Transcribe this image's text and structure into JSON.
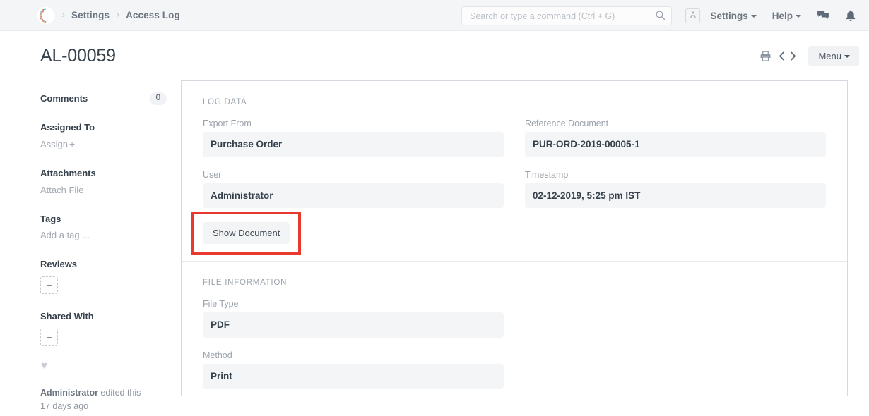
{
  "navbar": {
    "logo_name": "frappe-logo",
    "breadcrumbs": [
      {
        "label": "Settings"
      },
      {
        "label": "Access Log"
      }
    ],
    "separator": "›",
    "search": {
      "placeholder": "Search or type a command (Ctrl + G)",
      "value": "",
      "icon": "search-icon"
    },
    "avatar_initial": "A",
    "menus": [
      {
        "label": "Settings"
      },
      {
        "label": "Help"
      }
    ],
    "icons": [
      {
        "name": "chat-icon"
      },
      {
        "name": "bell-icon"
      }
    ]
  },
  "title_row": {
    "title": "AL-00059",
    "print_icon": "print-icon",
    "prev_icon": "chevron-left-icon",
    "next_icon": "chevron-right-icon",
    "menu_label": "Menu"
  },
  "sidebar": {
    "comments": {
      "label": "Comments",
      "count": "0"
    },
    "assigned_to": {
      "label": "Assigned To",
      "action": "Assign",
      "plus": "+"
    },
    "attachments": {
      "label": "Attachments",
      "action": "Attach File",
      "plus": "+"
    },
    "tags": {
      "label": "Tags",
      "action": "Add a tag ..."
    },
    "reviews": {
      "label": "Reviews",
      "add": "+"
    },
    "shared_with": {
      "label": "Shared With",
      "add": "+"
    },
    "like_icon": "♥",
    "footer": {
      "user": "Administrator",
      "action": " edited this",
      "time": "17 days ago"
    }
  },
  "content": {
    "sections": [
      {
        "title": "LOG DATA",
        "fields_left": [
          {
            "label": "Export From",
            "value": "Purchase Order"
          },
          {
            "label": "User",
            "value": "Administrator"
          }
        ],
        "fields_right": [
          {
            "label": "Reference Document",
            "value": "PUR-ORD-2019-00005-1"
          },
          {
            "label": "Timestamp",
            "value": "02-12-2019, 5:25 pm IST"
          }
        ],
        "button": {
          "label": "Show Document",
          "highlighted": true
        }
      },
      {
        "title": "FILE INFORMATION",
        "fields_left": [
          {
            "label": "File Type",
            "value": "PDF"
          },
          {
            "label": "Method",
            "value": "Print"
          }
        ],
        "fields_right": []
      }
    ]
  },
  "colors": {
    "highlight": "#e8392f",
    "navbar_bg": "#f4f5f6",
    "field_bg": "#f4f5f7",
    "text_dark": "#36414c",
    "text_muted": "#9aa2ab"
  }
}
